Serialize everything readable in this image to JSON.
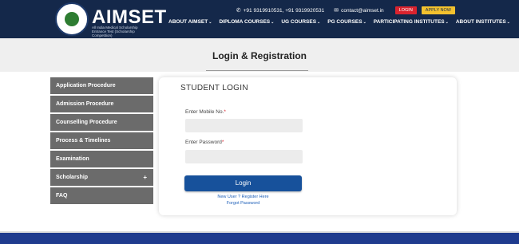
{
  "header": {
    "brand": "AIMSET",
    "tagline": "All India Medical Scholarship Entrance Test (Scholarship Competition)",
    "phone": "+91 9319910531, +91 9319920531",
    "email": "contact@aimset.in",
    "login_label": "LOGIN",
    "apply_label": "APPLY NOW",
    "nav": [
      {
        "label": "ABOUT AIMSET"
      },
      {
        "label": "DIPLOMA COURSES"
      },
      {
        "label": "UG COURSES"
      },
      {
        "label": "PG COURSES"
      },
      {
        "label": "PARTICIPATING INSTITUTES"
      },
      {
        "label": "ABOUT INSTITUTES"
      }
    ]
  },
  "page": {
    "title": "Login & Registration"
  },
  "sidebar": {
    "items": [
      {
        "label": "Application Procedure"
      },
      {
        "label": "Admission Procedure"
      },
      {
        "label": "Counselling Procedure"
      },
      {
        "label": "Process & Timelines"
      },
      {
        "label": "Examination"
      },
      {
        "label": "Scholarship",
        "expand": "+"
      },
      {
        "label": "FAQ"
      }
    ]
  },
  "login": {
    "title": "STUDENT LOGIN",
    "mobile_label": "Enter Mobile No.",
    "password_label": "Enter Password",
    "required_mark": "*",
    "button": "Login",
    "register_link": "New User ? Register Here",
    "forgot_link": "Forgot Password"
  },
  "colors": {
    "header_bg": "#14284a",
    "login_button": "#17519b",
    "sidebar_item": "#6b6b6b",
    "accent_red": "#d9232e",
    "accent_yellow": "#f2c12e"
  }
}
